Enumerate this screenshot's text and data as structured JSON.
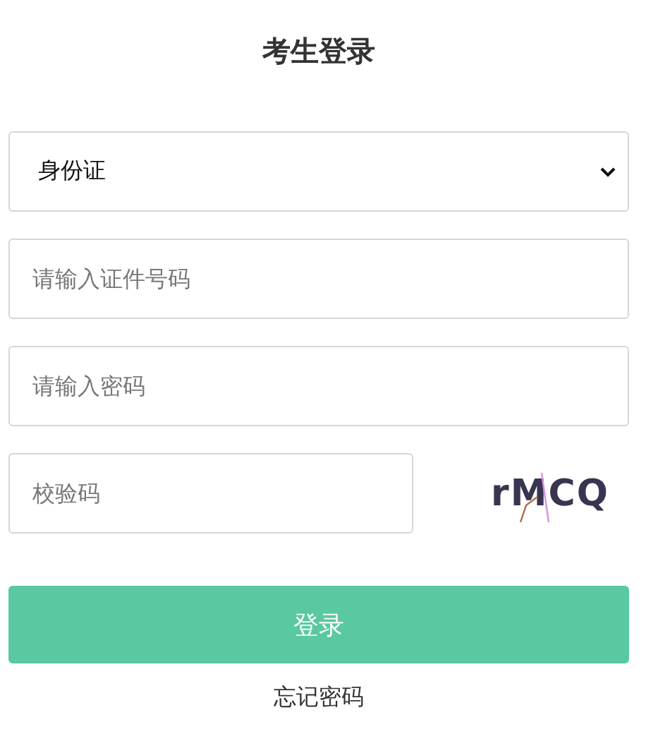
{
  "title": "考生登录",
  "id_type": {
    "value": "身份证"
  },
  "id_number": {
    "placeholder": "请输入证件号码"
  },
  "password": {
    "placeholder": "请输入密码"
  },
  "captcha": {
    "placeholder": "校验码",
    "code": "rMCQ"
  },
  "login_button": "登录",
  "forgot_link": "忘记密码"
}
